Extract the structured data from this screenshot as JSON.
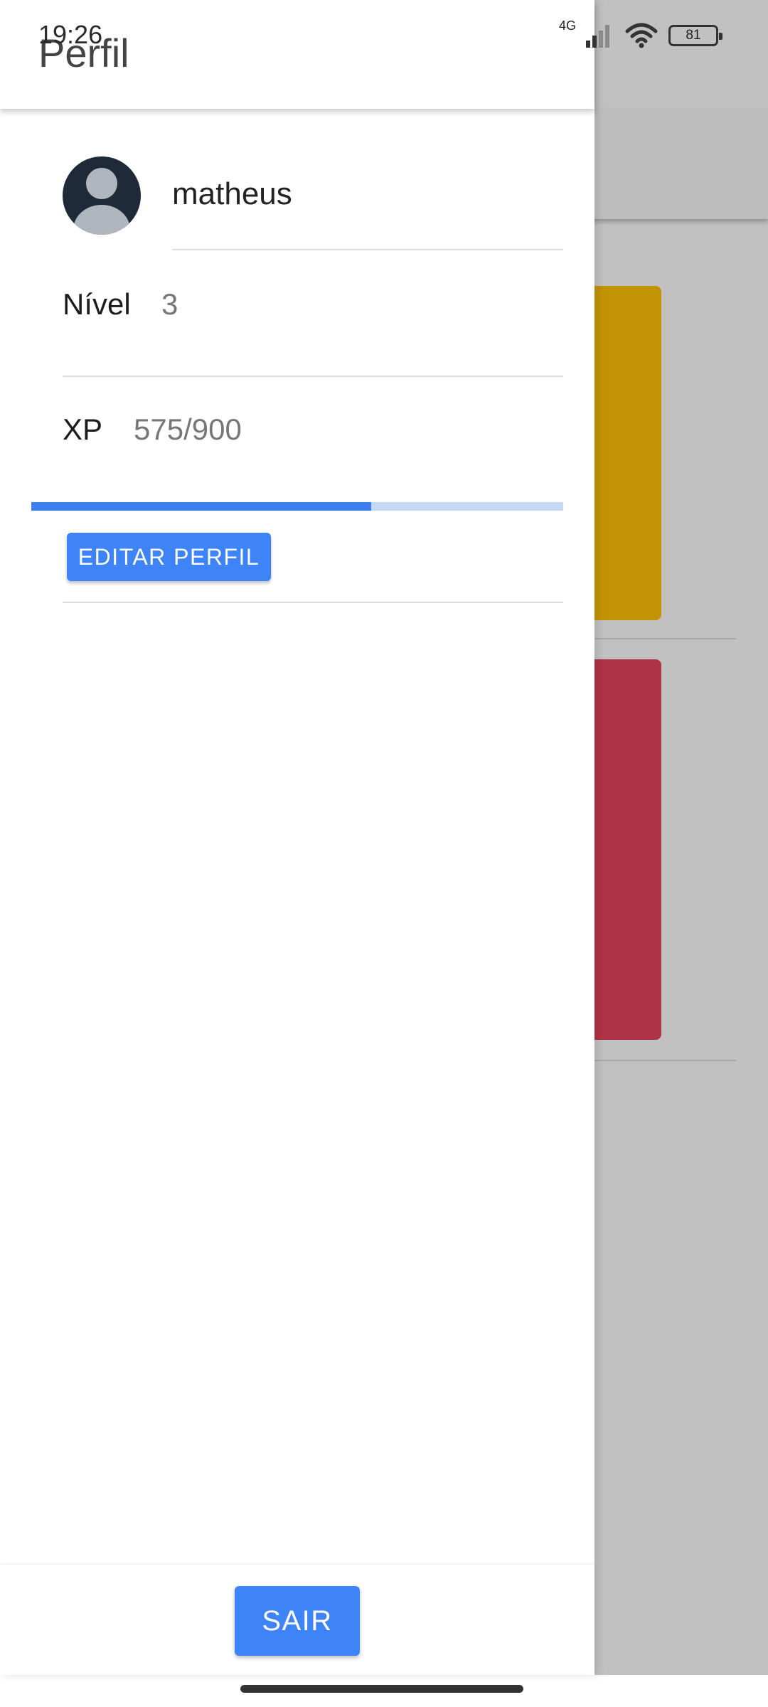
{
  "status_bar": {
    "time": "19:26",
    "network": "4G",
    "battery": "81"
  },
  "drawer": {
    "title": "Perfil",
    "username": "matheus",
    "level": {
      "label": "Nível",
      "value": "3"
    },
    "xp": {
      "label": "XP",
      "value": "575/900",
      "progress": 0.639
    },
    "edit_button": "EDITAR PERFIL",
    "logout_button": "SAIR"
  },
  "colors": {
    "accent": "#3f83f8",
    "progress_track": "#c5d9f6",
    "card_yellow": "#c29405",
    "card_red": "#ad3345",
    "scrim": "#c1c1c1"
  }
}
